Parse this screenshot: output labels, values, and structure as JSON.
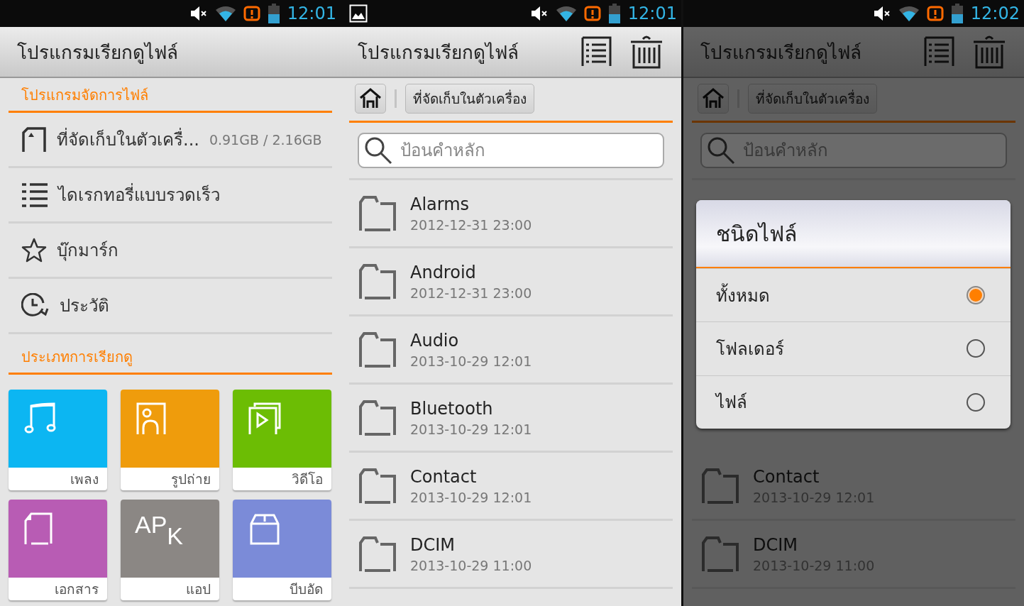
{
  "screens": [
    {
      "kind": "home",
      "dimmed": false,
      "status_bar": {
        "time": "12:01",
        "picture_notice": false
      },
      "title": "โปรแกรมเรียกดูไฟล์",
      "sections": [
        {
          "heading": "โปรแกรมจัดการไฟล์",
          "items": [
            {
              "kind": "storage",
              "label": "ที่จัดเก็บในตัวเครื่...",
              "size": "0.91GB / 2.16GB"
            },
            {
              "kind": "quick",
              "label": "ไดเรกทอรี่แบบรวดเร็ว"
            },
            {
              "kind": "bookmark",
              "label": "บุ๊กมาร์ก"
            },
            {
              "kind": "history",
              "label": "ประวัติ"
            }
          ]
        },
        {
          "heading": "ประเภทการเรียกดู",
          "tiles": [
            {
              "kind": "music",
              "label": "เพลง",
              "color": "#0cb6f2"
            },
            {
              "kind": "photo",
              "label": "รูปถ่าย",
              "color": "#ef9c0c"
            },
            {
              "kind": "video",
              "label": "วิดีโอ",
              "color": "#6cbd04"
            },
            {
              "kind": "document",
              "label": "เอกสาร",
              "color": "#b85cb4"
            },
            {
              "kind": "apk",
              "label": "แอป",
              "color": "#8b8784",
              "glyph": "AP",
              "glyph_sub": "K"
            },
            {
              "kind": "archive",
              "label": "บีบอัด",
              "color": "#7b8bd8"
            }
          ]
        }
      ]
    },
    {
      "kind": "browser",
      "dimmed": false,
      "status_bar": {
        "time": "12:01",
        "picture_notice": true
      },
      "title": "โปรแกรมเรียกดูไฟล์",
      "breadcrumb": "ที่จัดเก็บในตัวเครื่อง",
      "search": {
        "placeholder": "ป้อนคำหลัก"
      },
      "files": [
        {
          "name": "Alarms",
          "date": "2012-12-31 23:00"
        },
        {
          "name": "Android",
          "date": "2012-12-31 23:00"
        },
        {
          "name": "Audio",
          "date": "2013-10-29 12:01"
        },
        {
          "name": "Bluetooth",
          "date": "2013-10-29 12:01"
        },
        {
          "name": "Contact",
          "date": "2013-10-29 12:01"
        },
        {
          "name": "DCIM",
          "date": "2013-10-29 11:00"
        }
      ]
    },
    {
      "kind": "browser",
      "dimmed": true,
      "status_bar": {
        "time": "12:02",
        "picture_notice": false
      },
      "title": "โปรแกรมเรียกดูไฟล์",
      "breadcrumb": "ที่จัดเก็บในตัวเครื่อง",
      "search": {
        "placeholder": "ป้อนคำหลัก"
      },
      "dialog": {
        "title": "ชนิดไฟล์",
        "options": [
          {
            "label": "ทั้งหมด",
            "selected": true
          },
          {
            "label": "โฟลเดอร์",
            "selected": false
          },
          {
            "label": "ไฟล์",
            "selected": false
          }
        ]
      },
      "files": [
        {
          "name": "Contact",
          "date": "2013-10-29 12:01"
        },
        {
          "name": "DCIM",
          "date": "2013-10-29 11:00"
        }
      ]
    }
  ]
}
